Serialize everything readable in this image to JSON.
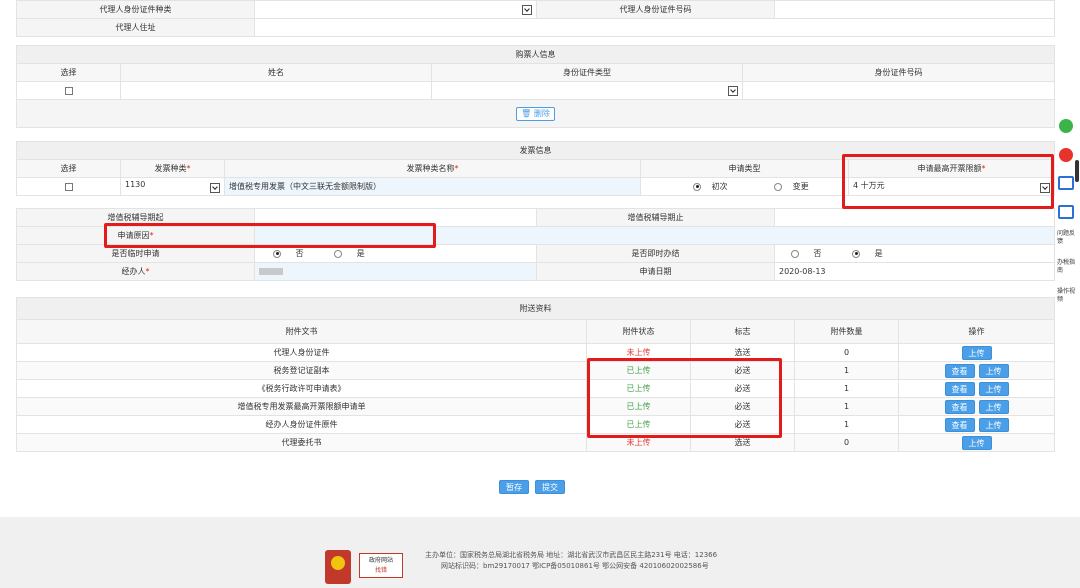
{
  "top_rows": {
    "agent_id_type_label": "代理人身份证件种类",
    "agent_id_no_label": "代理人身份证件号码",
    "agent_address_label": "代理人住址"
  },
  "buyer": {
    "title": "购票人信息",
    "headers": [
      "选择",
      "姓名",
      "身份证件类型",
      "身份证件号码"
    ],
    "delete_label": "删除"
  },
  "invoice": {
    "title": "发票信息",
    "headers": {
      "select": "选择",
      "type": "发票种类",
      "name": "发票种类名称",
      "apply_type": "申请类型",
      "max_limit": "申请最高开票限额"
    },
    "row": {
      "type": "1130",
      "name": "增值税专用发票（中文三联无金额限制版）",
      "apply_first": "初次",
      "apply_change": "变更",
      "max_limit": "4 十万元"
    }
  },
  "form": {
    "guidance_start_label": "增值税辅导期起",
    "guidance_end_label": "增值税辅导期止",
    "reason_label": "申请原因",
    "temp_label": "是否临时申请",
    "temp_no": "否",
    "temp_yes": "是",
    "instant_label": "是否即时办结",
    "instant_no": "否",
    "instant_yes": "是",
    "handler_label": "经办人",
    "date_label": "申请日期",
    "date_value": "2020-08-13"
  },
  "attachments": {
    "title": "附送资料",
    "headers": [
      "附件文书",
      "附件状态",
      "标志",
      "附件数量",
      "操作"
    ],
    "view_label": "查看",
    "upload_label": "上传",
    "rows": [
      {
        "name": "代理人身份证件",
        "status": "未上传",
        "flag": "选送",
        "count": "0",
        "uploaded": false
      },
      {
        "name": "税务登记证副本",
        "status": "已上传",
        "flag": "必送",
        "count": "1",
        "uploaded": true
      },
      {
        "name": "《税务行政许可申请表》",
        "status": "已上传",
        "flag": "必送",
        "count": "1",
        "uploaded": true
      },
      {
        "name": "增值税专用发票最高开票限额申请单",
        "status": "已上传",
        "flag": "必送",
        "count": "1",
        "uploaded": true
      },
      {
        "name": "经办人身份证件原件",
        "status": "已上传",
        "flag": "必送",
        "count": "1",
        "uploaded": true
      },
      {
        "name": "代理委托书",
        "status": "未上传",
        "flag": "选送",
        "count": "0",
        "uploaded": false
      }
    ]
  },
  "actions": {
    "save_label": "暂存",
    "submit_label": "提交"
  },
  "footer": {
    "line1": "主办单位：国家税务总局湖北省税务局   地址：湖北省武汉市武昌区民主路231号  电话：12366",
    "line2": "网站标识码：bm29170017   鄂ICP备05010861号   鄂公网安备 42010602002586号",
    "gov_badge_top": "政府网站",
    "gov_badge_bottom": "找错"
  },
  "sidebar": {
    "items": [
      "问题反馈",
      "办税指南",
      "操作视频"
    ]
  },
  "colors": {
    "accent": "#4a9fe8",
    "highlight": "#e41b1b",
    "uploaded": "#43a047",
    "not_uploaded": "#e53935"
  }
}
